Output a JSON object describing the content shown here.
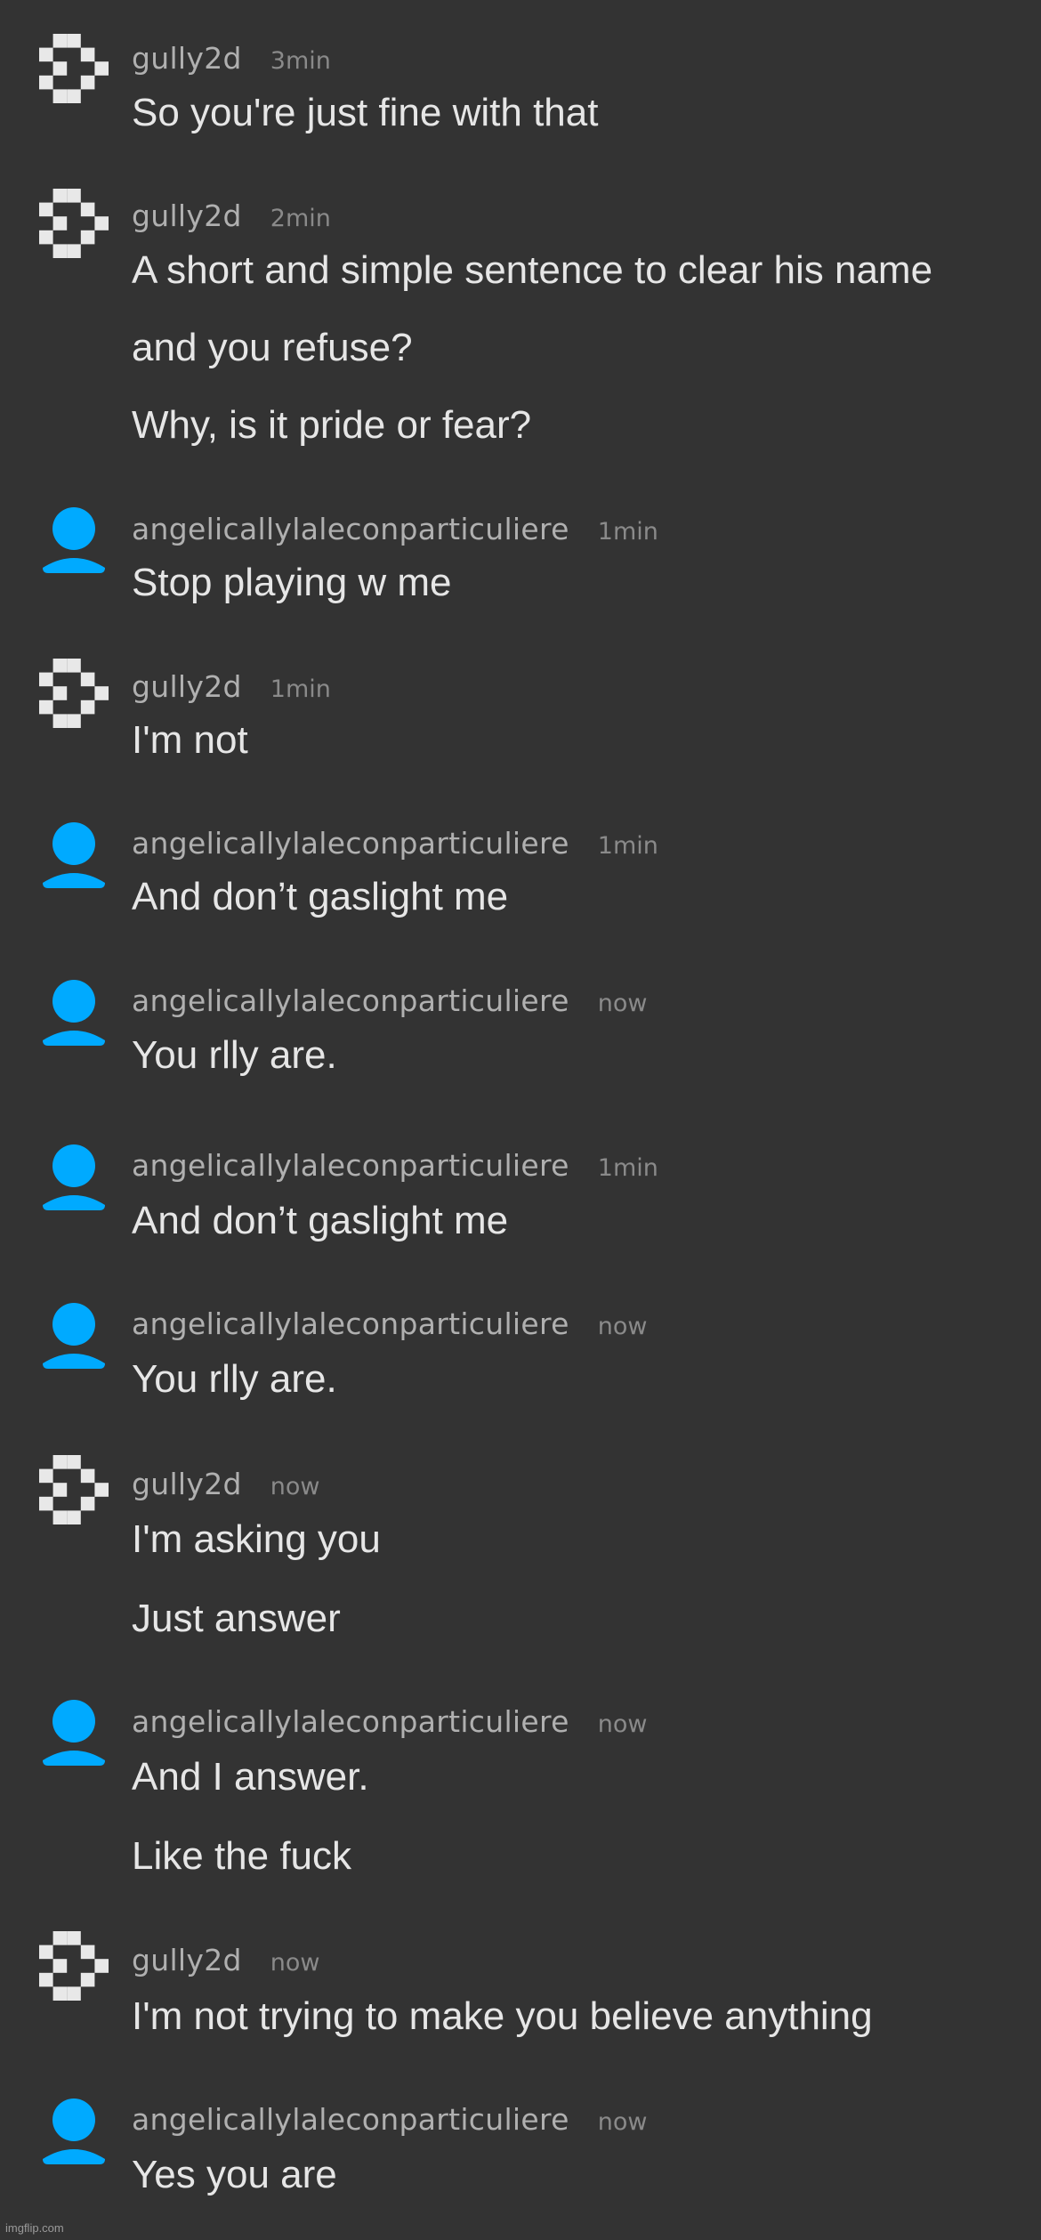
{
  "colors": {
    "background": "#333333",
    "username": "#b0b0b0",
    "timestamp": "#8a8a8a",
    "message": "#e6e6e6",
    "default_avatar": "#00aaff",
    "identicon": "#e8e8e8"
  },
  "messages": [
    {
      "user": "gully2d",
      "avatar": "identicon-icon",
      "time": "3min",
      "lines": [
        "So you're just fine with that"
      ]
    },
    {
      "user": "gully2d",
      "avatar": "identicon-icon",
      "time": "2min",
      "lines": [
        "A short and simple sentence to clear his name",
        "and you refuse?",
        "Why, is it pride or fear?"
      ]
    },
    {
      "user": "angelicallylaleconparticuliere",
      "avatar": "user-icon",
      "time": "1min",
      "lines": [
        "Stop playing w me"
      ]
    },
    {
      "user": "gully2d",
      "avatar": "identicon-icon",
      "time": "1min",
      "lines": [
        "I'm not"
      ]
    },
    {
      "user": "angelicallylaleconparticuliere",
      "avatar": "user-icon",
      "time": "1min",
      "lines": [
        "And don’t gaslight me"
      ]
    },
    {
      "user": "angelicallylaleconparticuliere",
      "avatar": "user-icon",
      "time": "now",
      "lines": [
        "You rlly are."
      ]
    },
    {
      "user": "angelicallylaleconparticuliere",
      "avatar": "user-icon",
      "time": "1min",
      "lines": [
        "And don’t gaslight me"
      ]
    },
    {
      "user": "angelicallylaleconparticuliere",
      "avatar": "user-icon",
      "time": "now",
      "lines": [
        "You rlly are."
      ]
    },
    {
      "user": "gully2d",
      "avatar": "identicon-icon",
      "time": "now",
      "lines": [
        "I'm asking you",
        "Just answer"
      ]
    },
    {
      "user": "angelicallylaleconparticuliere",
      "avatar": "user-icon",
      "time": "now",
      "lines": [
        "And I answer.",
        "Like the fuck"
      ]
    },
    {
      "user": "gully2d",
      "avatar": "identicon-icon",
      "time": "now",
      "lines": [
        "I'm not trying to make you believe anything"
      ]
    },
    {
      "user": "angelicallylaleconparticuliere",
      "avatar": "user-icon",
      "time": "now",
      "lines": [
        "Yes you are"
      ]
    }
  ],
  "watermark": "imgflip.com"
}
